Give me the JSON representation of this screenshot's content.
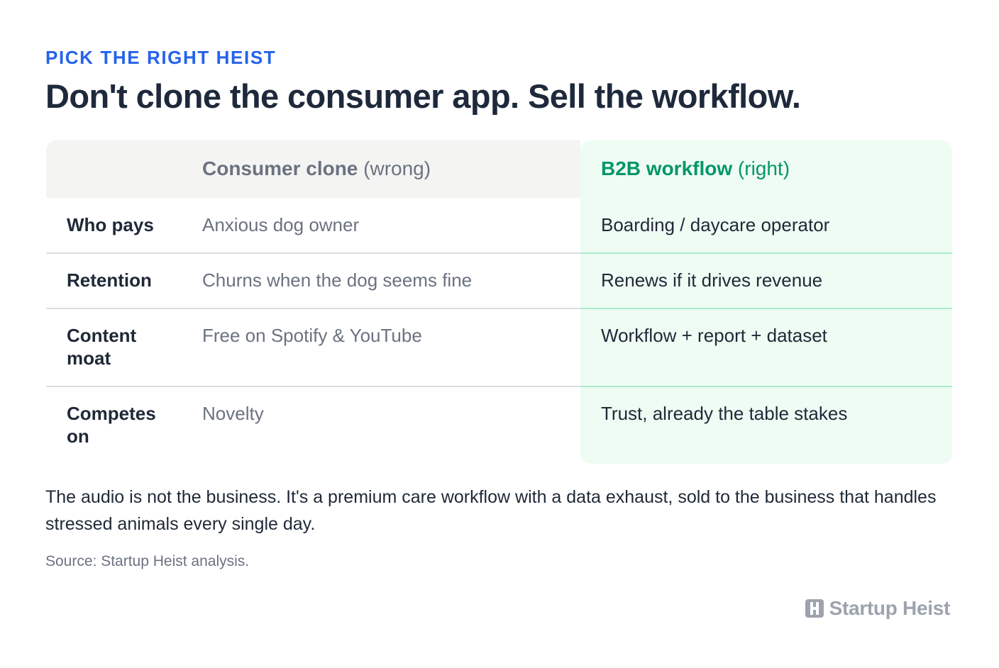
{
  "eyebrow": "PICK THE RIGHT HEIST",
  "headline": "Don't clone the consumer app. Sell the workflow.",
  "table": {
    "header": {
      "wrong_strong": "Consumer clone",
      "wrong_note": "(wrong)",
      "right_strong": "B2B workflow",
      "right_note": "(right)"
    },
    "rows": [
      {
        "label": "Who pays",
        "wrong": "Anxious dog owner",
        "right": "Boarding / daycare operator"
      },
      {
        "label": "Retention",
        "wrong": "Churns when the dog seems fine",
        "right": "Renews if it drives revenue"
      },
      {
        "label": "Content moat",
        "wrong": "Free on Spotify & YouTube",
        "right": "Workflow + report + dataset"
      },
      {
        "label": "Competes on",
        "wrong": "Novelty",
        "right": "Trust, already the table stakes"
      }
    ]
  },
  "body": "The audio is not the business. It's a premium care workflow with a data exhaust, sold to the business that handles stressed animals every single day.",
  "source": "Source: Startup Heist analysis.",
  "brand": {
    "name": "Startup Heist",
    "icon": "h-logo-icon"
  },
  "colors": {
    "accent_blue": "#2563eb",
    "accent_green": "#059669",
    "right_column_bg": "#effcf4",
    "header_bg": "#f4f4f3"
  }
}
